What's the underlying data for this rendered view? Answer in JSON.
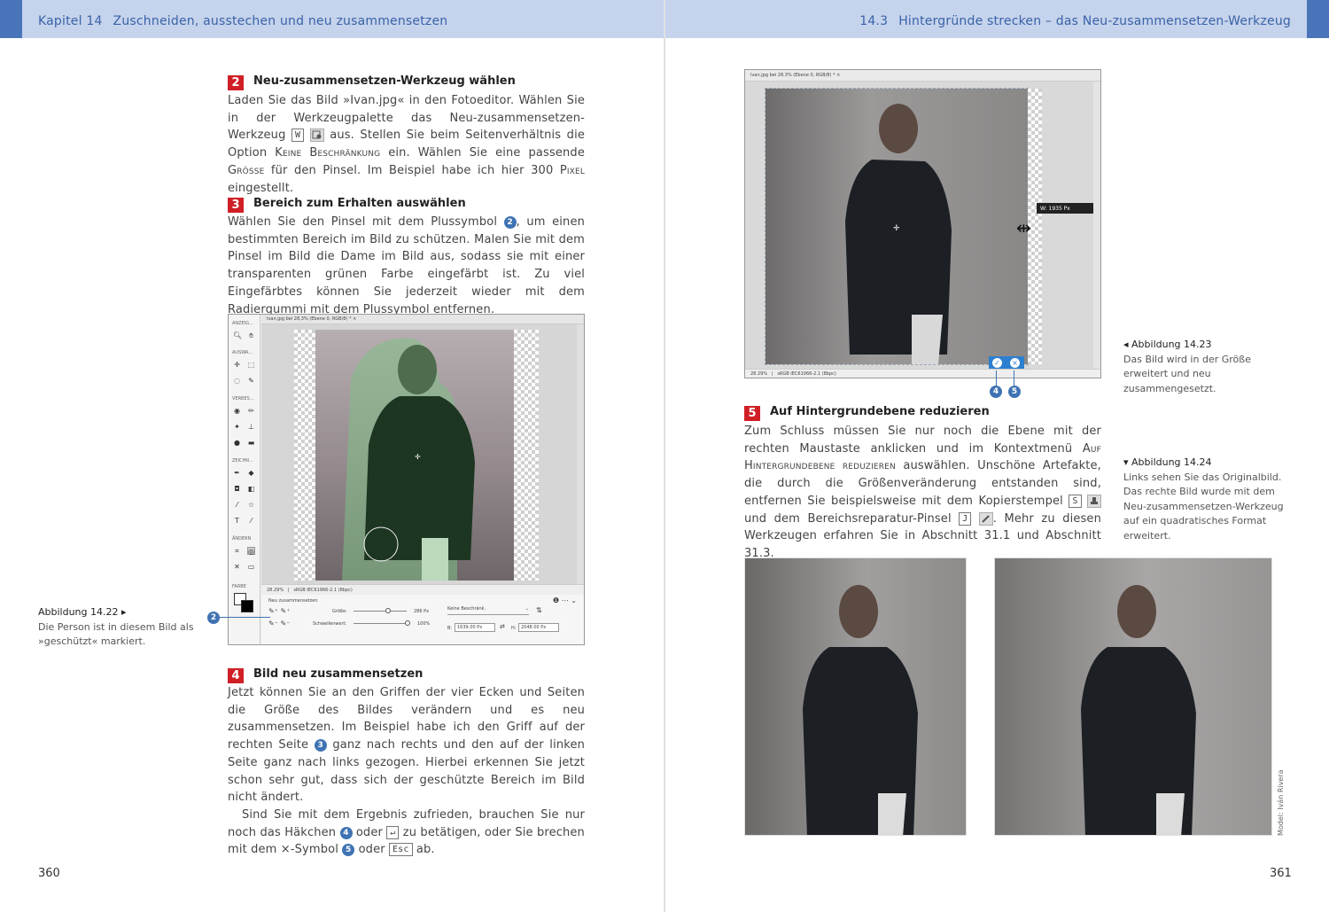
{
  "header_left": {
    "chapter": "Kapitel 14",
    "title": "Zuschneiden, ausstechen und neu zusammensetzen"
  },
  "header_right": {
    "section": "14.3",
    "title": "Hintergründe strecken – das Neu-zusammensetzen-Werkzeug"
  },
  "steps": {
    "s2": {
      "num": "2",
      "heading": "Neu-zusammensetzen-Werkzeug wählen",
      "text_a": "Laden Sie das Bild »Ivan.jpg« in den Fotoeditor. Wählen Sie in der Werkzeugpalette das Neu-zusammensetzen-Werkzeug",
      "key": "W",
      "text_b": "aus. Stellen Sie beim Seitenverhältnis die Option",
      "sc1": "Keine Beschränkung",
      "text_c": "ein. Wählen Sie eine passende",
      "sc2": "Grösse",
      "text_d": "für den Pinsel. Im Beispiel habe ich hier 300",
      "sc3": "Pixel",
      "text_e": "eingestellt."
    },
    "s3": {
      "num": "3",
      "heading": "Bereich zum Erhalten auswählen",
      "text_a": "Wählen Sie den Pinsel mit dem Plussymbol",
      "badge": "2",
      "text_b": ", um einen bestimmten Bereich im Bild zu schützen. Malen Sie mit dem Pinsel im Bild die Dame im Bild aus, sodass sie mit einer transparenten grünen Farbe eingefärbt ist. Zu viel Eingefärbtes können Sie jederzeit wieder mit dem Radiergummi mit dem Plussymbol entfernen."
    },
    "s4": {
      "num": "4",
      "heading": "Bild neu zusammensetzen",
      "text_a": "Jetzt können Sie an den Griffen der vier Ecken und Seiten die Größe des Bildes verändern und es neu zusammensetzen. Im Beispiel habe ich den Griff auf der rechten Seite",
      "badge_a": "3",
      "text_b": "ganz nach rechts und den auf der linken Seite ganz nach links gezogen. Hierbei erkennen Sie jetzt schon sehr gut, dass sich der geschützte Bereich im Bild nicht ändert.",
      "text_c": "Sind Sie mit dem Ergebnis zufrieden, brauchen Sie nur noch das Häkchen",
      "badge_b": "4",
      "text_d": "oder",
      "key_enter": "↵",
      "text_e": "zu betätigen, oder Sie brechen mit dem ×-Symbol",
      "badge_c": "5",
      "text_f": "oder",
      "key_esc": "Esc",
      "text_g": "ab."
    },
    "s5": {
      "num": "5",
      "heading": "Auf Hintergrundebene reduzieren",
      "text_a": "Zum Schluss müssen Sie nur noch die Ebene mit der rechten Maustaste anklicken und im Kontextmenü",
      "sc1": "Auf Hintergrundebene reduzieren",
      "text_b": "auswählen. Unschöne Artefakte, die durch die Größenveränderung entstanden sind, entfernen Sie beispielsweise mit dem Kopierstempel",
      "key_s": "S",
      "text_c": "und dem Bereichsreparatur-Pinsel",
      "key_j": "J",
      "text_d": ". Mehr zu diesen Werkzeugen erfahren Sie in Abschnitt 31.1 und Abschnitt 31.3."
    }
  },
  "captions": {
    "c1422": {
      "title": "Abbildung 14.22 ▸",
      "text": "Die Person ist in diesem Bild als »geschützt« markiert."
    },
    "c1423": {
      "title": "◂ Abbildung 14.23",
      "text": "Das Bild wird in der Größe erweitert und neu zusammengesetzt."
    },
    "c1424": {
      "title": "▾ Abbildung 14.24",
      "text": "Links sehen Sie das Originalbild. Das rechte Bild wurde mit dem Neu-zusammensetzen-Werkzeug auf ein quadratisches Format erweitert."
    }
  },
  "fig1": {
    "tab": "Ivan.jpg bei 28,3% (Ebene 0, RGB/8) *",
    "zoom": "28.29%",
    "profile": "sRGB IEC61966-2.1 (8bpc)",
    "sections": [
      "ANZEIG...",
      "AUSWA...",
      "VERBES...",
      "ZEICHN...",
      "ÄNDERN",
      "FARBE"
    ],
    "tool_name": "Neu zusammensetzen",
    "size_label": "Größe:",
    "size_value": "286 Px",
    "threshold_label": "Schwellenwert:",
    "threshold_value": "100%",
    "ratio": "Keine Beschränk.",
    "w_label": "B:",
    "w_value": "1639.00 Px",
    "h_label": "H:",
    "h_value": "2048.00 Px",
    "callout": "2"
  },
  "fig2": {
    "tab": "Ivan.jpg bei 28.3% (Ebene 0, RGB/8) *",
    "zoom": "28.29%",
    "profile": "sRGB IEC61966-2.1 (8bpc)",
    "tooltip": "W:    1935 Px",
    "callout_a": "4",
    "callout_b": "5"
  },
  "credit": "Model: Iván Rivera",
  "page_left": "360",
  "page_right": "361",
  "colors": {
    "accent_blue": "#4a74b9",
    "header_bg": "#c5d3ec",
    "step_red": "#d01f26",
    "badge_blue": "#3f73b3"
  }
}
